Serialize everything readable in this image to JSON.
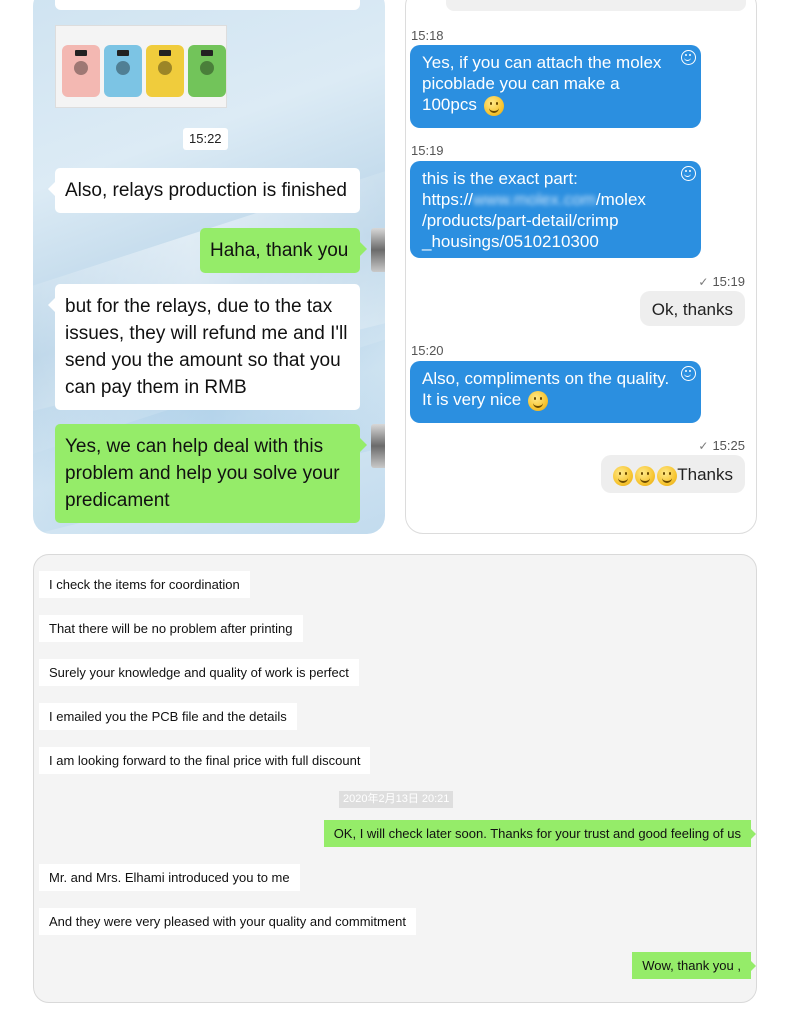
{
  "colors": {
    "wechat_green": "#95ec69",
    "skype_blue": "#2b8fe0",
    "bubble_white": "#ffffff",
    "bubble_gray": "#eeeeee"
  },
  "panel_a": {
    "timestamp": "15:22",
    "messages": [
      {
        "side": "left",
        "text": "Also, relays production is finished"
      },
      {
        "side": "right",
        "text": "Haha, thank you"
      },
      {
        "side": "left",
        "text": "but for the relays, due to the tax issues, they will refund me and I'll send you the amount so that you can pay them in RMB"
      },
      {
        "side": "right",
        "text": "Yes, we can help deal with this problem and help you solve your predicament"
      }
    ],
    "photo_icon": "product-photo"
  },
  "panel_b": {
    "messages": [
      {
        "time": "15:18",
        "text": "Yes, if you can attach the molex picoblade you can make a 100pcs",
        "emoji": "smile-emoji"
      },
      {
        "time": "15:19",
        "text_line1": "this is the exact part:",
        "link_prefix": "https://",
        "link_blurred": "www.molex.com",
        "link_rest": "/molex /products/part-detail/crimp _housings/0510210300"
      },
      {
        "time": "15:19",
        "text": "Ok, thanks",
        "sent": true
      },
      {
        "time": "15:20",
        "text": "Also, compliments on the quality. It is very nice",
        "emoji": "smile-emoji"
      },
      {
        "time": "15:25",
        "text": "Thanks",
        "sent": true,
        "emoji_count": 3
      }
    ]
  },
  "panel_c": {
    "messages": [
      {
        "side": "left",
        "text": "I check the items for coordination"
      },
      {
        "side": "left",
        "text": "That there will be no problem after printing"
      },
      {
        "side": "left",
        "text": "Surely your knowledge and quality of work is perfect"
      },
      {
        "side": "left",
        "text": "I emailed you the PCB file and the details"
      },
      {
        "side": "left",
        "text": "I am looking forward to the final price with full discount"
      },
      {
        "side": "right",
        "text": "OK, I will check later soon. Thanks for your trust and good feeling of us"
      },
      {
        "side": "left",
        "text": "Mr. and Mrs. Elhami introduced you to me"
      },
      {
        "side": "left",
        "text": "And they were very pleased with your quality and commitment"
      },
      {
        "side": "right",
        "text": "Wow, thank you ,"
      }
    ],
    "date_divider": "2020年2月13日 20:21"
  }
}
